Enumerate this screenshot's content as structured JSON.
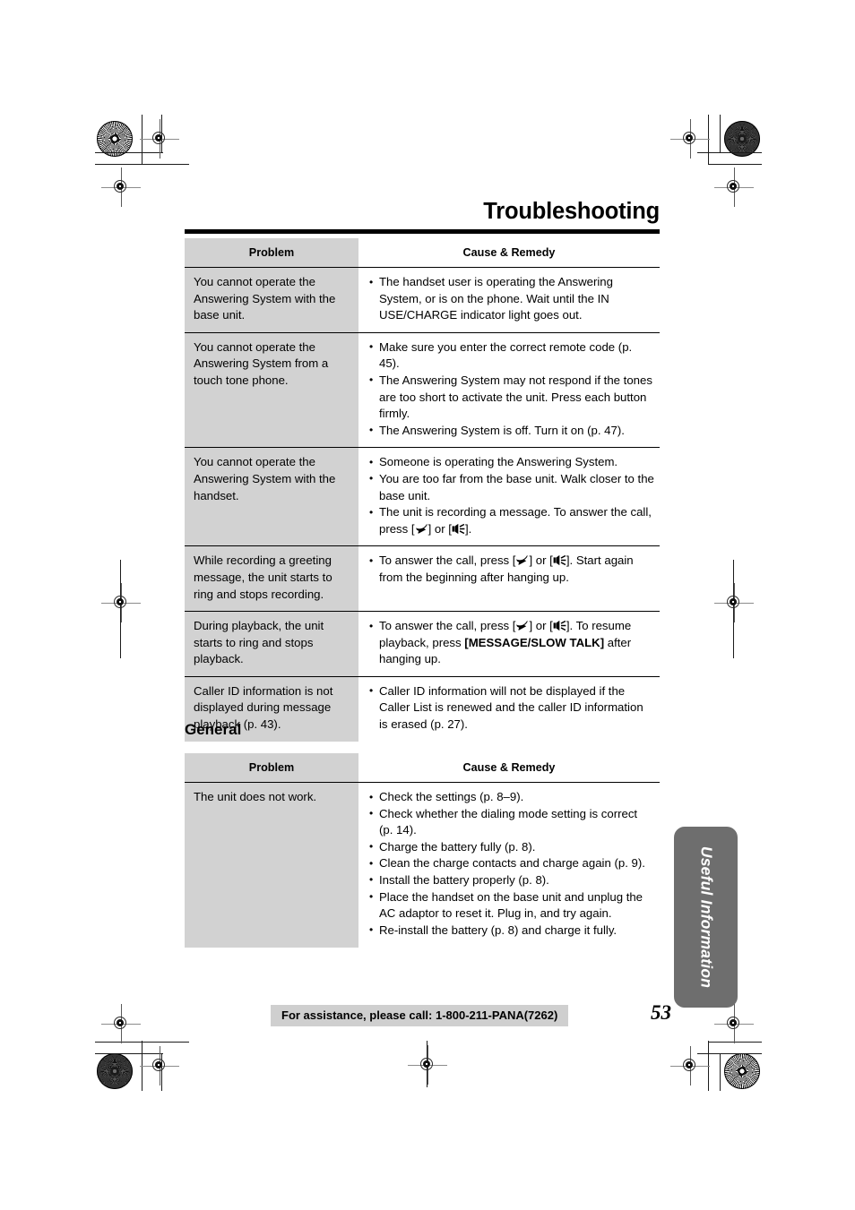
{
  "document": {
    "chapter_title": "Troubleshooting",
    "page_number": "53",
    "thumb_tab_label": "Useful Information",
    "footer_note": "For assistance, please call: 1-800-211-PANA(7262)",
    "section_heading_general": "General",
    "colors": {
      "problem_cell_bg": "#d2d2d2",
      "thumb_tab_bg": "#6e6e6e",
      "footer_band_bg": "#cfcfcf",
      "rule": "#000000"
    }
  },
  "table_answering": {
    "headers": {
      "problem": "Problem",
      "cause_remedy": "Cause & Remedy"
    },
    "rows": [
      {
        "problem": "You cannot operate the Answering System with the base unit.",
        "remedies": [
          {
            "parts": [
              {
                "t": "text",
                "v": "The handset user is operating the Answering System, or is on the phone. Wait until the IN USE/CHARGE indicator light goes out."
              }
            ]
          }
        ]
      },
      {
        "problem": "You cannot operate the Answering System from a touch tone phone.",
        "remedies": [
          {
            "parts": [
              {
                "t": "text",
                "v": "Make sure you enter the correct remote code (p. 45)."
              }
            ]
          },
          {
            "parts": [
              {
                "t": "text",
                "v": "The Answering System may not respond if the tones are too short to activate the unit. Press each button firmly."
              }
            ]
          },
          {
            "parts": [
              {
                "t": "text",
                "v": "The Answering System is off. Turn it on (p. 47)."
              }
            ]
          }
        ]
      },
      {
        "problem": "You cannot operate the Answering System with the handset.",
        "remedies": [
          {
            "parts": [
              {
                "t": "text",
                "v": "Someone is operating the Answering System."
              }
            ]
          },
          {
            "parts": [
              {
                "t": "text",
                "v": "You are too far from the base unit. Walk closer to the base unit."
              }
            ]
          },
          {
            "parts": [
              {
                "t": "text",
                "v": "The unit is recording a message. To answer the call, press ["
              },
              {
                "t": "icon",
                "v": "talk-handset-icon"
              },
              {
                "t": "text",
                "v": "] or ["
              },
              {
                "t": "icon",
                "v": "speakerphone-icon"
              },
              {
                "t": "text",
                "v": "]."
              }
            ]
          }
        ]
      },
      {
        "problem": "While recording a greeting message, the unit starts to ring and stops recording.",
        "remedies": [
          {
            "parts": [
              {
                "t": "text",
                "v": "To answer the call, press ["
              },
              {
                "t": "icon",
                "v": "talk-handset-icon"
              },
              {
                "t": "text",
                "v": "] or ["
              },
              {
                "t": "icon",
                "v": "speakerphone-icon"
              },
              {
                "t": "text",
                "v": "]. Start again from the beginning after hanging up."
              }
            ]
          }
        ]
      },
      {
        "problem": "During playback, the unit starts to ring and stops playback.",
        "remedies": [
          {
            "parts": [
              {
                "t": "text",
                "v": "To answer the call, press ["
              },
              {
                "t": "icon",
                "v": "talk-handset-icon"
              },
              {
                "t": "text",
                "v": "] or ["
              },
              {
                "t": "icon",
                "v": "speakerphone-icon"
              },
              {
                "t": "text",
                "v": "]. To resume playback, press "
              },
              {
                "t": "bold",
                "v": "[MESSAGE/SLOW TALK]"
              },
              {
                "t": "text",
                "v": " after hanging up."
              }
            ]
          }
        ]
      },
      {
        "problem": "Caller ID information is not displayed during message playback (p. 43).",
        "remedies": [
          {
            "parts": [
              {
                "t": "text",
                "v": "Caller ID information will not be displayed if the Caller List is renewed and the caller ID information is erased (p. 27)."
              }
            ]
          }
        ]
      }
    ]
  },
  "table_general": {
    "headers": {
      "problem": "Problem",
      "cause_remedy": "Cause & Remedy"
    },
    "rows": [
      {
        "problem": "The unit does not work.",
        "remedies": [
          {
            "parts": [
              {
                "t": "text",
                "v": "Check the settings (p. 8–9)."
              }
            ]
          },
          {
            "parts": [
              {
                "t": "text",
                "v": "Check whether the dialing mode setting is correct (p. 14)."
              }
            ]
          },
          {
            "parts": [
              {
                "t": "text",
                "v": "Charge the battery fully (p. 8)."
              }
            ]
          },
          {
            "parts": [
              {
                "t": "text",
                "v": "Clean the charge contacts and charge again (p. 9)."
              }
            ]
          },
          {
            "parts": [
              {
                "t": "text",
                "v": "Install the battery properly (p. 8)."
              }
            ]
          },
          {
            "parts": [
              {
                "t": "text",
                "v": "Place the handset on the base unit and unplug the AC adaptor to reset it. Plug in, and try again."
              }
            ]
          },
          {
            "parts": [
              {
                "t": "text",
                "v": "Re-install the battery (p. 8) and charge it fully."
              }
            ]
          }
        ]
      }
    ]
  }
}
